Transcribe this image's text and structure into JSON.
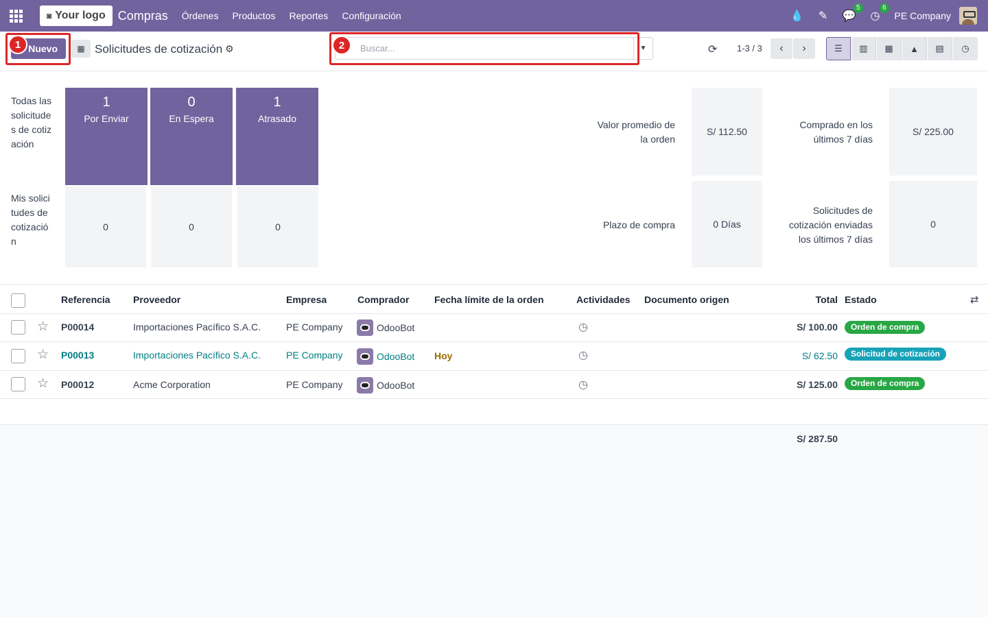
{
  "navbar": {
    "logo_text": "Your logo",
    "app_name": "Compras",
    "menu": [
      "Órdenes",
      "Productos",
      "Reportes",
      "Configuración"
    ],
    "messages_count": "5",
    "activities_count": "6",
    "company": "PE Company"
  },
  "control": {
    "new_button": "Nuevo",
    "breadcrumb": "Solicitudes de cotización",
    "search_placeholder": "Buscar...",
    "pager": "1-3 / 3",
    "step1": "1",
    "step2": "2"
  },
  "dashboard": {
    "row1_label": "Todas las solicitudes de cotización",
    "row2_label": "Mis solicitudes de cotización",
    "tiles": [
      {
        "count": "1",
        "label": "Por Enviar",
        "mine": "0"
      },
      {
        "count": "0",
        "label": "En Espera",
        "mine": "0"
      },
      {
        "count": "1",
        "label": "Atrasado",
        "mine": "0"
      }
    ],
    "kpis": [
      {
        "label": "Valor promedio de la orden",
        "value": "S/ 112.50"
      },
      {
        "label": "Comprado en los últimos 7 días",
        "value": "S/ 225.00"
      },
      {
        "label": "Plazo de compra",
        "value": "0 Días"
      },
      {
        "label": "Solicitudes de cotización enviadas los últimos 7 días",
        "value": "0"
      }
    ]
  },
  "table": {
    "headers": [
      "Referencia",
      "Proveedor",
      "Empresa",
      "Comprador",
      "Fecha límite de la orden",
      "Actividades",
      "Documento origen",
      "Total",
      "Estado"
    ],
    "rows": [
      {
        "ref": "P00014",
        "vendor": "Importaciones Pacífico S.A.C.",
        "company": "PE Company",
        "buyer": "OdooBot",
        "deadline": "",
        "total": "S/ 100.00",
        "status": "Orden de compra"
      },
      {
        "ref": "P00013",
        "vendor": "Importaciones Pacífico S.A.C.",
        "company": "PE Company",
        "buyer": "OdooBot",
        "deadline": "Hoy",
        "total": "S/ 62.50",
        "status": "Solicitud de cotización"
      },
      {
        "ref": "P00012",
        "vendor": "Acme Corporation",
        "company": "PE Company",
        "buyer": "OdooBot",
        "deadline": "",
        "total": "S/ 125.00",
        "status": "Orden de compra"
      }
    ],
    "sum_total": "S/ 287.50"
  },
  "colors": {
    "brand": "#71639e",
    "highlight": "#dc2626",
    "success": "#28a745",
    "info": "#17a2b8",
    "link": "#017e84"
  }
}
